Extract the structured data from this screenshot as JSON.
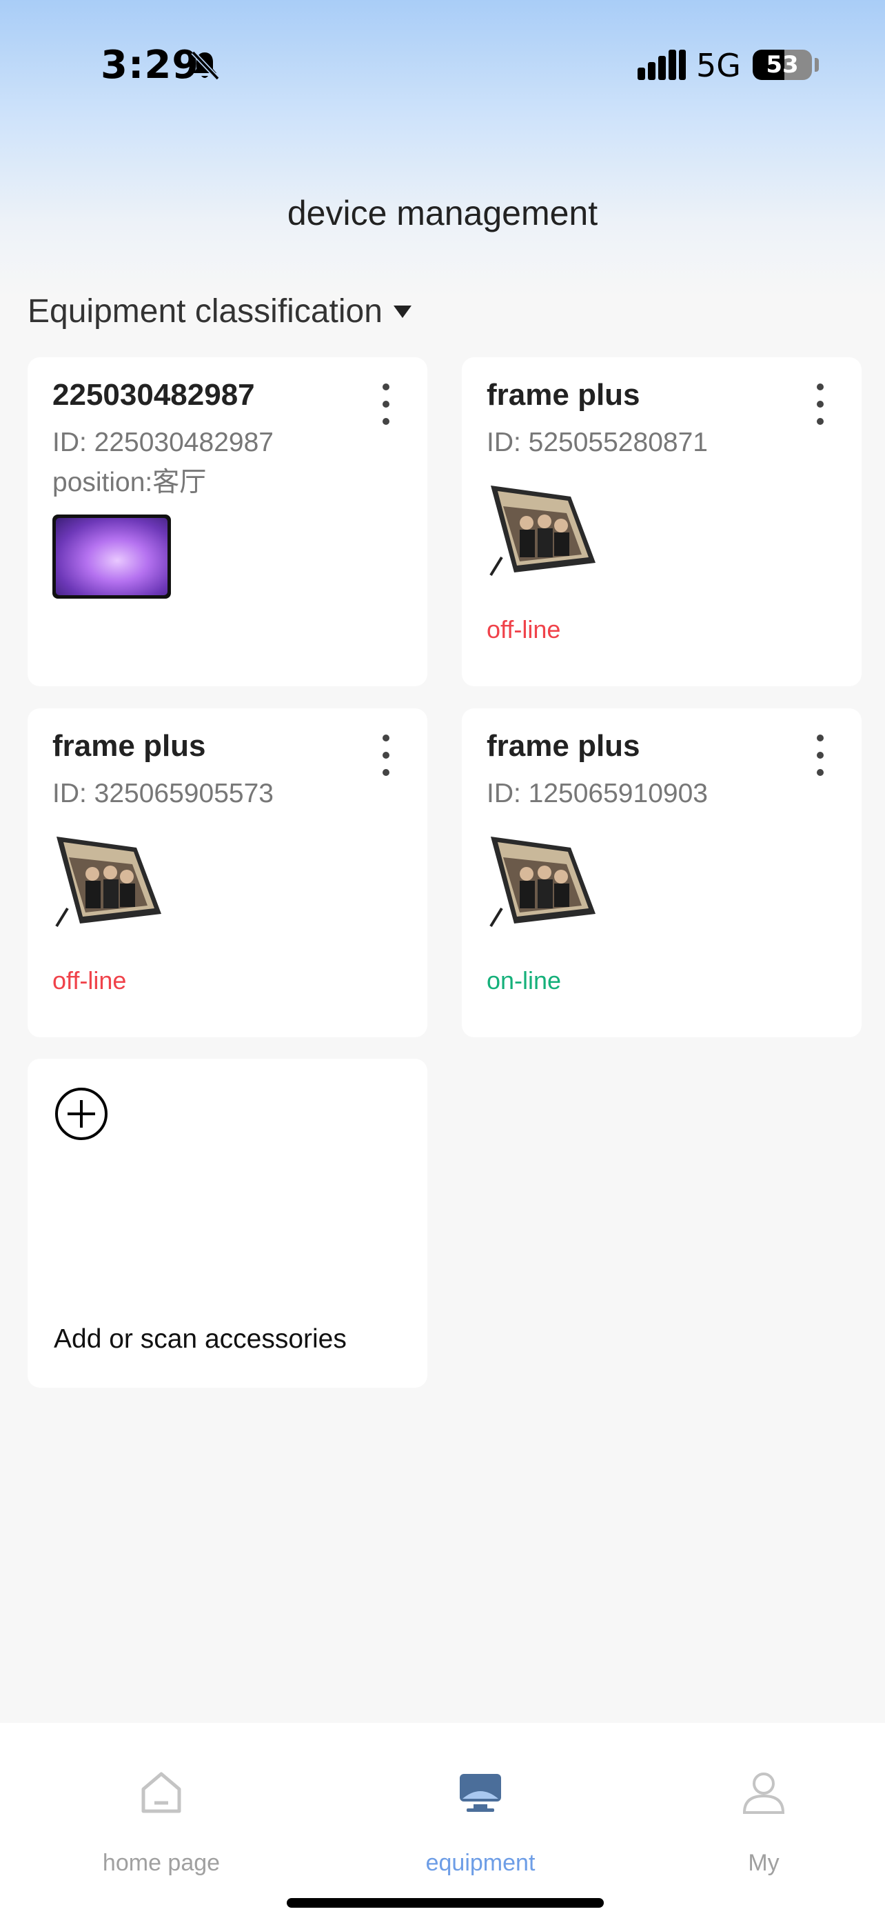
{
  "status_bar": {
    "time": "3:29",
    "network": "5G",
    "battery": "53",
    "battery_level": 0.53
  },
  "header": {
    "title": "device management"
  },
  "filter": {
    "label": "Equipment classification"
  },
  "devices": [
    {
      "name": "225030482987",
      "id": "ID: 225030482987",
      "position": "position:客厅",
      "thumbnail": "tablet-image",
      "status": ""
    },
    {
      "name": "frame plus",
      "id": "ID: 525055280871",
      "position": "",
      "thumbnail": "photo-frame-image",
      "status": "off-line"
    },
    {
      "name": "frame plus",
      "id": "ID: 325065905573",
      "position": "",
      "thumbnail": "photo-frame-image",
      "status": "off-line"
    },
    {
      "name": "frame plus",
      "id": "ID: 125065910903",
      "position": "",
      "thumbnail": "photo-frame-image",
      "status": "on-line"
    }
  ],
  "add_card": {
    "label": "Add or scan accessories",
    "icon": "plus-circle-icon"
  },
  "colors": {
    "offline": "#f0424a",
    "online": "#15b07a",
    "tab_active": "#6d9de6",
    "tab_inactive": "#a0a0a0"
  },
  "tab_bar": {
    "tabs": [
      {
        "label": "home page",
        "icon": "home-icon",
        "active": false
      },
      {
        "label": "equipment",
        "icon": "monitor-icon",
        "active": true
      },
      {
        "label": "My",
        "icon": "user-icon",
        "active": false
      }
    ]
  }
}
